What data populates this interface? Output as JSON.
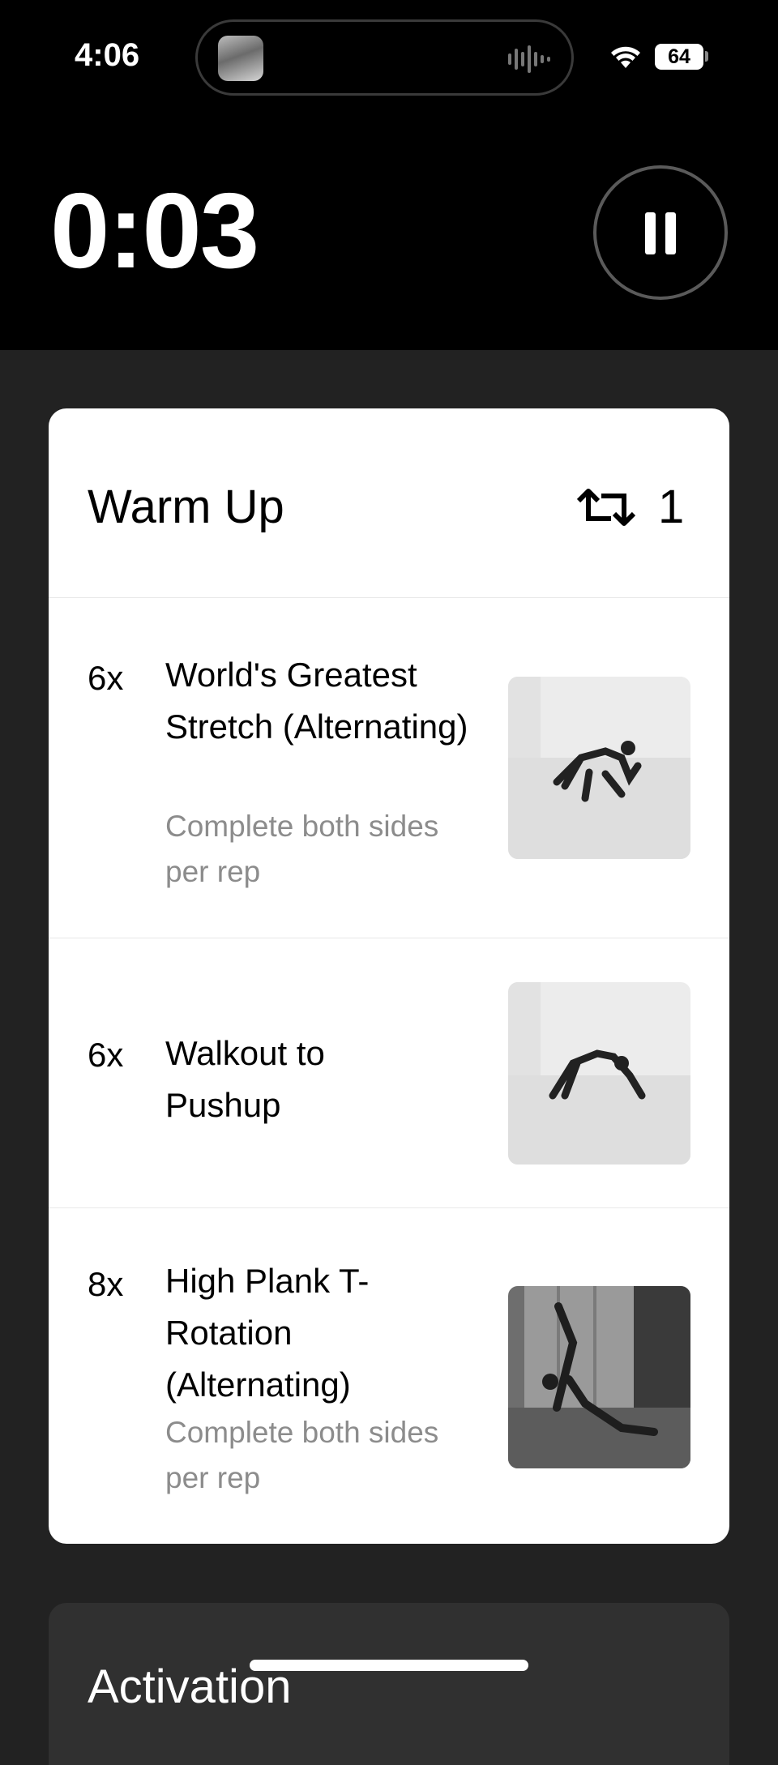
{
  "status_bar": {
    "time": "4:06",
    "battery": "64"
  },
  "timer": {
    "elapsed": "0:03"
  },
  "section": {
    "title": "Warm Up",
    "rounds": "1",
    "exercises": [
      {
        "reps": "6x",
        "name": "World's Greatest Stretch (Alternating)",
        "note": "Complete both sides per rep"
      },
      {
        "reps": "6x",
        "name": "Walkout to Pushup",
        "note": ""
      },
      {
        "reps": "8x",
        "name": "High Plank T-Rotation (Alternating)",
        "note": "Complete both sides per rep"
      }
    ]
  },
  "next_section": {
    "title": "Activation"
  },
  "colors": {
    "background": "#222222",
    "card": "#ffffff",
    "accent": "#000000",
    "muted_text": "#8c8c8c"
  }
}
